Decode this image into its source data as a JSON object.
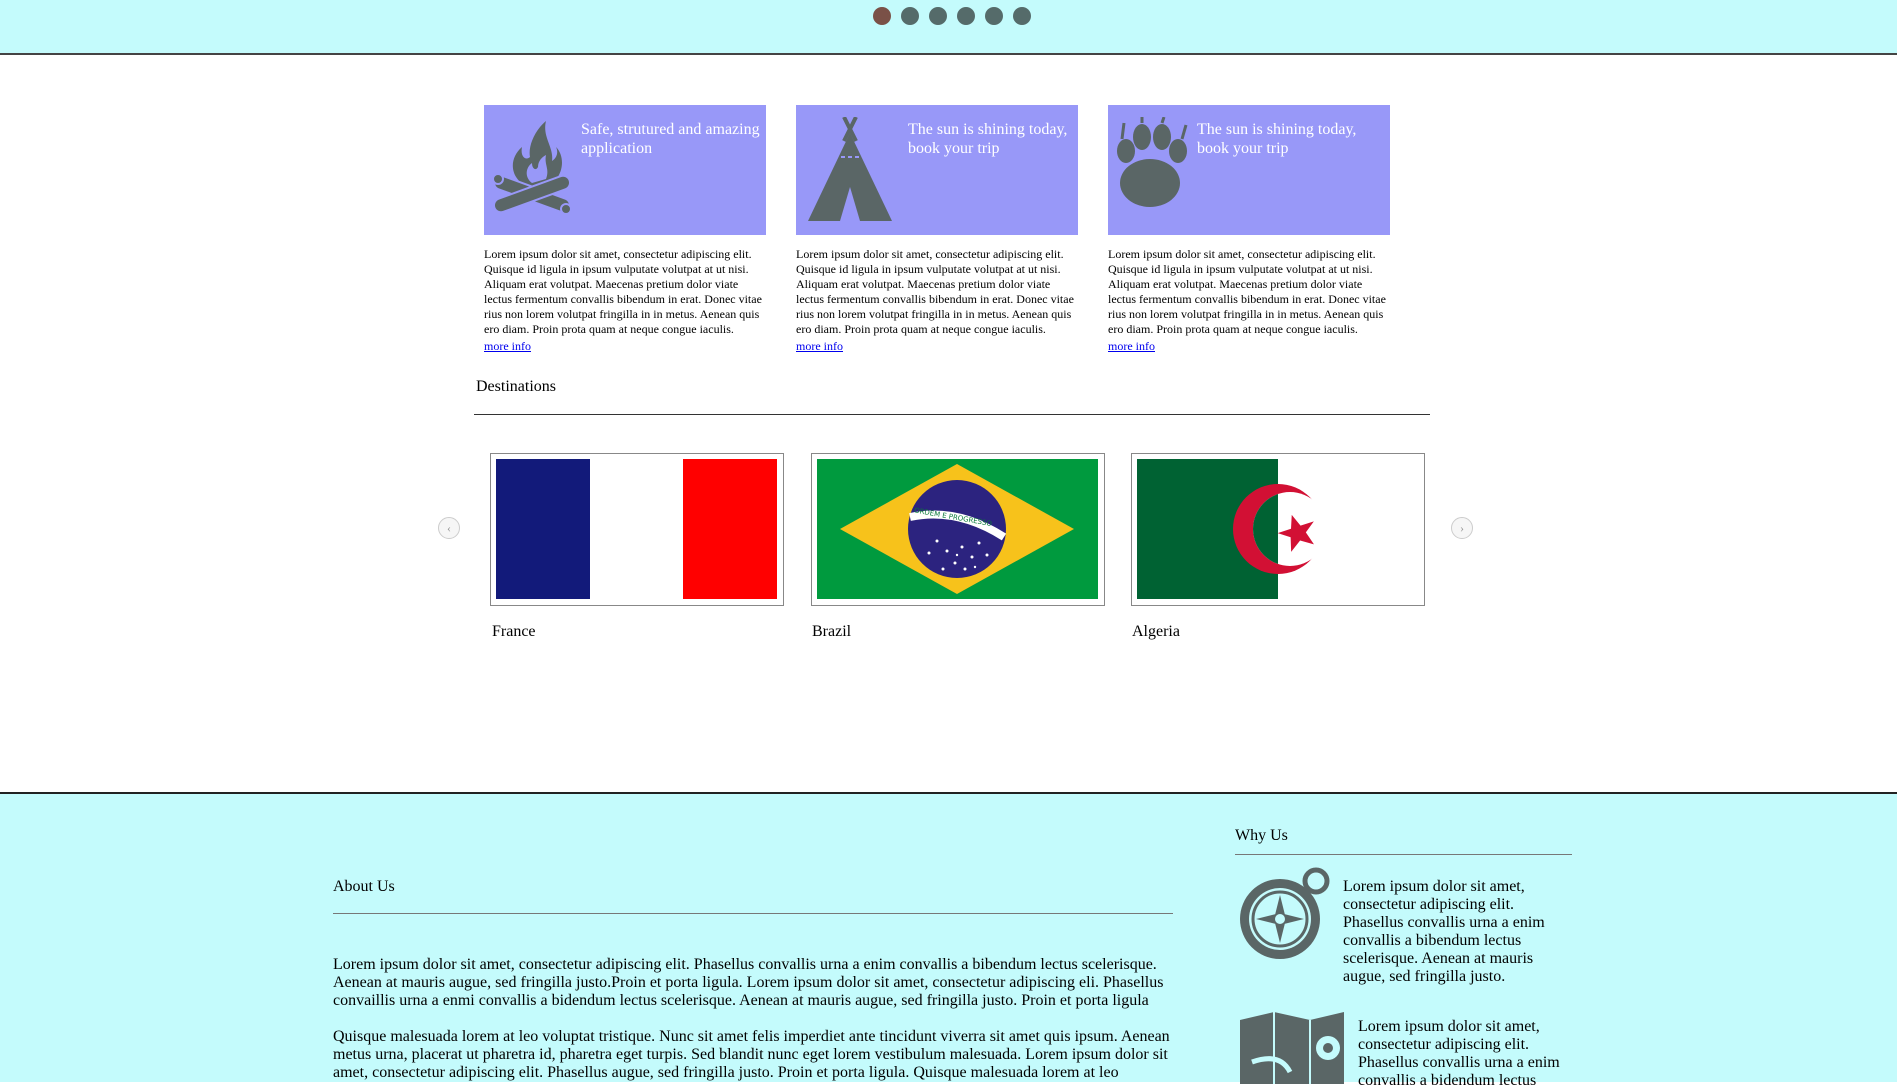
{
  "carousel": {
    "dots": [
      "slide-1",
      "slide-2",
      "slide-3",
      "slide-4",
      "slide-5",
      "slide-6"
    ],
    "active_index": 0
  },
  "features": [
    {
      "icon": "campfire-icon",
      "title": "Safe, strutured and amazing application",
      "description": "Lorem ipsum dolor sit amet, consectetur adipiscing elit. Quisque id ligula in ipsum vulputate volutpat at ut nisi. Aliquam erat volutpat. Maecenas pretium dolor viate lectus fermentum convallis bibendum in erat. Donec vitae rius non lorem volutpat fringilla in in metus. Aenean quis ero diam. Proin prota quam at neque congue iaculis.",
      "link": "more info"
    },
    {
      "icon": "tent-icon",
      "title": "The sun is shining today, book your trip",
      "description": "Lorem ipsum dolor sit amet, consectetur adipiscing elit. Quisque id ligula in ipsum vulputate volutpat at ut nisi. Aliquam erat volutpat. Maecenas pretium dolor viate lectus fermentum convallis bibendum in erat. Donec vitae rius non lorem volutpat fringilla in in metus. Aenean quis ero diam. Proin prota quam at neque congue iaculis.",
      "link": "more info"
    },
    {
      "icon": "paw-print-icon",
      "title": "The sun is shining today, book your trip",
      "description": "Lorem ipsum dolor sit amet, consectetur adipiscing elit. Quisque id ligula in ipsum vulputate volutpat at ut nisi. Aliquam erat volutpat. Maecenas pretium dolor viate lectus fermentum convallis bibendum in erat. Donec vitae rius non lorem volutpat fringilla in in metus. Aenean quis ero diam. Proin prota quam at neque congue iaculis.",
      "link": "more info"
    }
  ],
  "destinations": {
    "title": "Destinations",
    "prev_icon": "chevron-left-icon",
    "next_icon": "chevron-right-icon",
    "items": [
      {
        "name": "France",
        "flag": "france-flag"
      },
      {
        "name": "Brazil",
        "flag": "brazil-flag",
        "motto": "ORDEM E PROGRESSO"
      },
      {
        "name": "Algeria",
        "flag": "algeria-flag"
      }
    ]
  },
  "footer": {
    "about": {
      "title": "About Us",
      "paragraphs": [
        "Lorem ipsum dolor sit amet, consectetur adipiscing elit. Phasellus convallis urna a enim convallis a bibendum lectus scelerisque. Aenean at mauris augue, sed fringilla justo.Proin et porta ligula. Lorem ipsum dolor sit amet, consectetur adipiscing eli. Phasellus convaillis urna a enmi convallis a bidendum lectus scelerisque. Aenean at mauris augue, sed fringilla justo. Proin et porta ligula",
        "Quisque malesuada lorem at leo voluptat tristique. Nunc sit amet felis imperdiet ante tincidunt viverra sit amet quis ipsum. Aenean metus urna, placerat ut pharetra id, pharetra eget turpis. Sed blandit nunc eget lorem vestibulum malesuada. Lorem ipsum dolor sit amet, consectetur adipiscing elit. Phasellus augue, sed fringilla justo. Proin et porta ligula. Quisque malesuada lorem at leo"
      ]
    },
    "why": {
      "title": "Why Us",
      "items": [
        {
          "icon": "compass-icon",
          "text": "Lorem ipsum dolor sit amet, consectetur adipiscing elit. Phasellus convallis urna a enim convallis a bibendum lectus scelerisque. Aenean at mauris augue, sed fringilla justo."
        },
        {
          "icon": "map-pin-icon",
          "text": "Lorem ipsum dolor sit amet, consectetur adipiscing elit. Phasellus convallis urna a enim convallis a bidendum lectus"
        }
      ]
    }
  },
  "colors": {
    "header_bg": "#c4fbfc",
    "feature_banner": "#9898f8",
    "icon_gray": "#5a6666",
    "active_dot": "#7a5147",
    "dot": "#556b6a",
    "france_blue": "#121a7a",
    "france_red": "#ff0000",
    "brazil_green": "#009a3e",
    "brazil_yellow": "#f7c21b",
    "brazil_blue": "#2c237f",
    "algeria_green": "#006233",
    "algeria_red": "#d21034"
  }
}
